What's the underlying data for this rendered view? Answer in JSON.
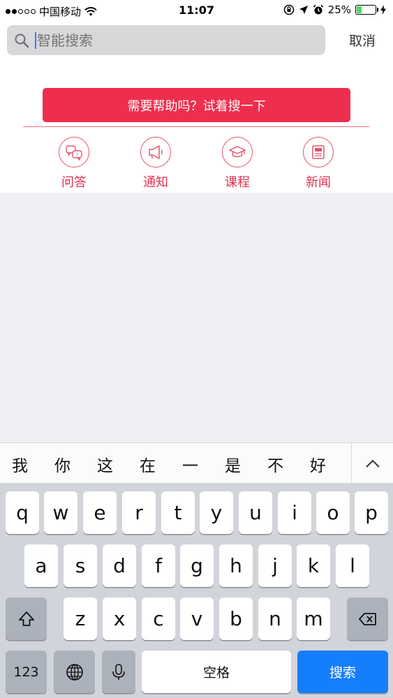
{
  "status_bar": {
    "carrier": "中国移动",
    "time": "11:07",
    "battery": "25%",
    "battery_level": 0.25
  },
  "search": {
    "placeholder": "智能搜索",
    "cancel_label": "取消"
  },
  "help": {
    "label": "需要帮助吗？试着搜一下"
  },
  "categories": [
    {
      "label": "问答",
      "icon": "chat-bubbles-icon"
    },
    {
      "label": "通知",
      "icon": "megaphone-icon"
    },
    {
      "label": "课程",
      "icon": "graduation-cap-icon"
    },
    {
      "label": "新闻",
      "icon": "newspaper-icon"
    }
  ],
  "candidates": [
    "我",
    "你",
    "这",
    "在",
    "一",
    "是",
    "不",
    "好"
  ],
  "keyboard": {
    "row1": [
      "q",
      "w",
      "e",
      "r",
      "t",
      "y",
      "u",
      "i",
      "o",
      "p"
    ],
    "row2": [
      "a",
      "s",
      "d",
      "f",
      "g",
      "h",
      "j",
      "k",
      "l"
    ],
    "row3": [
      "z",
      "x",
      "c",
      "v",
      "b",
      "n",
      "m"
    ],
    "numbers_label": "123",
    "space_label": "空格",
    "search_label": "搜索"
  },
  "colors": {
    "accent": "#ee2e4e",
    "keyboard_bg": "#d1d4da",
    "search_key": "#157efb"
  }
}
